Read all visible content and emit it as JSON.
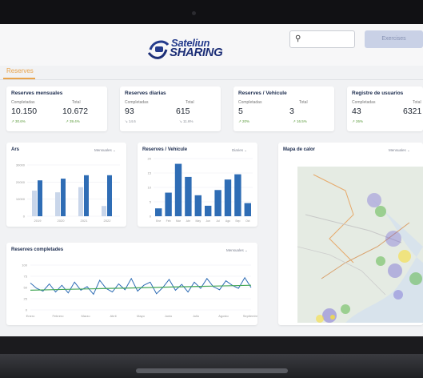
{
  "header": {
    "logo_line1": "SateliunSHARING",
    "logo_word1": "Sateliun",
    "logo_word2": "SHARING",
    "cta_label": "Exercises"
  },
  "search": {
    "icon": "search-icon"
  },
  "tabs": [
    {
      "label": "Reserves"
    }
  ],
  "kpis": [
    {
      "title": "Reserves mensuales",
      "sub1": "Completadas",
      "sub2": "Total",
      "v1": "10.150",
      "v2": "10.672",
      "d1": "↗ 30.6%",
      "d2": "↗ 39.4%"
    },
    {
      "title": "Reserves diarias",
      "sub1": "Completadas",
      "sub2": "Total",
      "v1": "93",
      "v2": "615",
      "d1": "↘ 14.6",
      "d2": "↘ 11.6%"
    },
    {
      "title": "Reserves / Vehicule",
      "sub1": "Completadas",
      "sub2": "Total",
      "v1": "5",
      "v2": "3",
      "d1": "↗ 20%",
      "d2": "↗ 16.5%"
    },
    {
      "title": "Registre de usuarios",
      "sub1": "Completadas",
      "sub2": "Total",
      "v1": "43",
      "v2": "6321",
      "d1": "↗ 26%",
      "d2": ""
    }
  ],
  "panels": {
    "year": {
      "title": "Ars",
      "select": "Mensuales ⌄"
    },
    "vehicle": {
      "title": "Reserves / Vehicule",
      "select": "Diaries ⌄"
    },
    "heatmap": {
      "title": "Mapa de calor",
      "select": "Mensuales ⌄"
    },
    "completed": {
      "title": "Reserves completades",
      "select": "Mensuales ⌄"
    }
  },
  "chart_data": [
    {
      "type": "bar",
      "title": "Ars",
      "categories": [
        "2019",
        "2020",
        "2021",
        "2022"
      ],
      "series": [
        {
          "values": [
            15000,
            14000,
            17000,
            6000
          ]
        },
        {
          "values": [
            21000,
            22000,
            24000,
            24000
          ]
        }
      ],
      "yticks": [
        "0",
        "10000",
        "20000",
        "30000"
      ],
      "ylim": [
        0,
        30000
      ],
      "colors": [
        "#c9d6ea",
        "#2f6db5"
      ]
    },
    {
      "type": "bar",
      "title": "Reserves / Vehicule",
      "categories": [
        "Ene",
        "Feb",
        "Mar",
        "Abr",
        "May",
        "Jun",
        "Jul",
        "Ago",
        "Sep",
        "Oct"
      ],
      "values": [
        3,
        9,
        20,
        15,
        8,
        4,
        10,
        14,
        16,
        5
      ],
      "yticks": [
        "0",
        "5",
        "10",
        "15",
        "20"
      ],
      "ylim": [
        0,
        22
      ],
      "color": "#2f6db5"
    },
    {
      "type": "line",
      "title": "Reserves completades",
      "categories": [
        "Enero",
        "Febrero",
        "Marzo",
        "Abril",
        "Mayo",
        "Junio",
        "Julio",
        "Agosto",
        "Septiembre"
      ],
      "series": [
        {
          "values": [
            60,
            48,
            42,
            58,
            40,
            55,
            38,
            62,
            44,
            52,
            35,
            66,
            48,
            40,
            58,
            45,
            70,
            42,
            55,
            62,
            36,
            50,
            68,
            44,
            57,
            40,
            62,
            48,
            70,
            52,
            45,
            65,
            55,
            48,
            72,
            50
          ]
        },
        {
          "values": [
            44,
            45,
            46,
            47,
            48,
            49,
            50,
            51,
            52,
            53,
            54,
            55
          ]
        }
      ],
      "yticks": [
        "0",
        "25",
        "50",
        "75",
        "100"
      ],
      "ylim": [
        0,
        100
      ],
      "colors": [
        "#2f6db5",
        "#46a858"
      ]
    }
  ]
}
